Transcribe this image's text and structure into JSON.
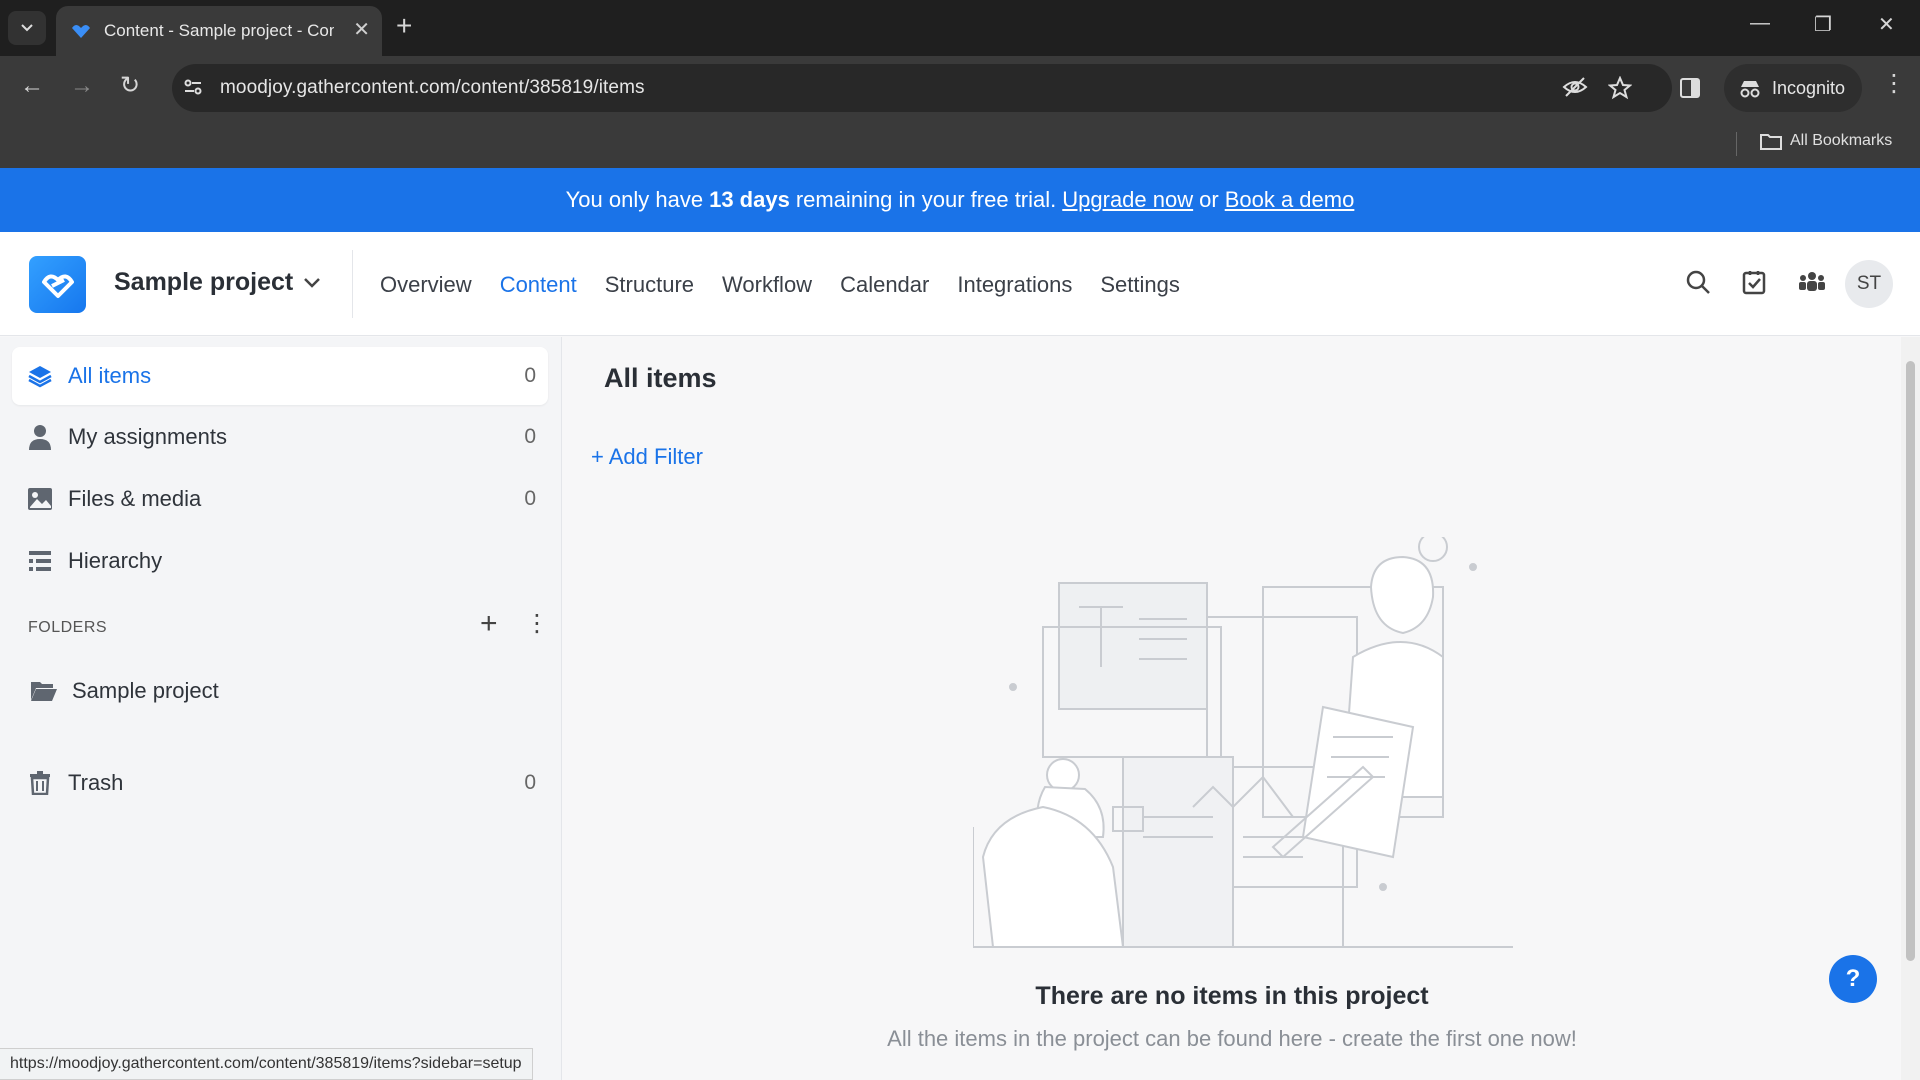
{
  "browser": {
    "tab_title": "Content - Sample project - Con",
    "url": "moodjoy.gathercontent.com/content/385819/items",
    "incognito_label": "Incognito",
    "bookmarks_label": "All Bookmarks",
    "status_url": "https://moodjoy.gathercontent.com/content/385819/items?sidebar=setup"
  },
  "banner": {
    "text_before": "You only have",
    "days": "13 days",
    "text_after": "remaining in your free trial.",
    "upgrade_link": "Upgrade now",
    "or_text": "or",
    "demo_link": "Book a demo"
  },
  "header": {
    "project_name": "Sample project",
    "nav": [
      "Overview",
      "Content",
      "Structure",
      "Workflow",
      "Calendar",
      "Integrations",
      "Settings"
    ],
    "active_nav": "Content",
    "avatar_initials": "ST"
  },
  "sidebar": {
    "items": [
      {
        "label": "All items",
        "count": "0",
        "icon": "layers-icon"
      },
      {
        "label": "My assignments",
        "count": "0",
        "icon": "user-icon"
      },
      {
        "label": "Files & media",
        "count": "0",
        "icon": "image-icon"
      },
      {
        "label": "Hierarchy",
        "count": "",
        "icon": "hierarchy-icon"
      }
    ],
    "folders_heading": "FOLDERS",
    "folders": [
      {
        "label": "Sample project",
        "icon": "folder-open-icon"
      }
    ],
    "trash": {
      "label": "Trash",
      "count": "0",
      "icon": "trash-icon"
    }
  },
  "main": {
    "title": "All items",
    "add_filter": "+ Add Filter",
    "empty_title": "There are no items in this project",
    "empty_subtitle": "All the items in the project can be found here - create the first one now!",
    "help_label": "?"
  },
  "colors": {
    "accent": "#1a73e8",
    "banner_bg": "#1a73e8",
    "browser_dark": "#1f1f1f"
  }
}
